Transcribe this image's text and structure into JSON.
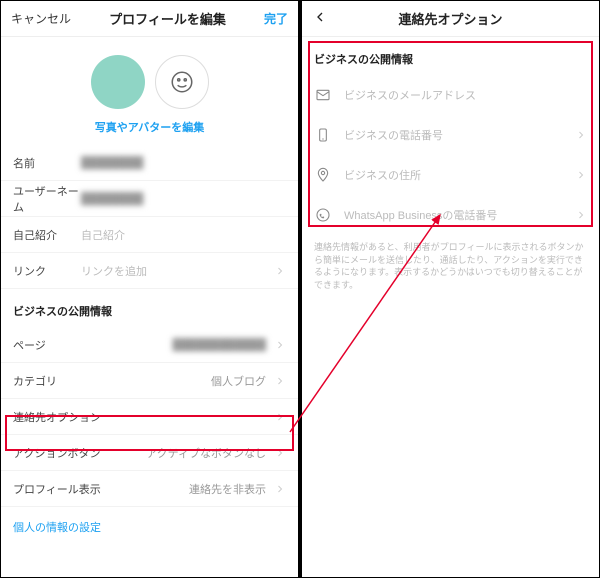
{
  "left": {
    "header": {
      "cancel": "キャンセル",
      "title": "プロフィールを編集",
      "done": "完了"
    },
    "avatar_link": "写真やアバターを編集",
    "fields": {
      "name_label": "名前",
      "username_label": "ユーザーネーム",
      "bio_label": "自己紹介",
      "bio_placeholder": "自己紹介",
      "links_label": "リンク",
      "links_placeholder": "リンクを追加"
    },
    "biz_section": "ビジネスの公開情報",
    "biz": {
      "page_label": "ページ",
      "category_label": "カテゴリ",
      "category_value": "個人ブログ",
      "contact_label": "連絡先オプション",
      "action_label": "アクションボタン",
      "action_value": "アクティブなボタンなし",
      "display_label": "プロフィール表示",
      "display_value": "連絡先を非表示"
    },
    "personal": "個人の情報の設定"
  },
  "right": {
    "header": {
      "title": "連絡先オプション"
    },
    "section_title": "ビジネスの公開情報",
    "rows": {
      "email": "ビジネスのメールアドレス",
      "phone": "ビジネスの電話番号",
      "address": "ビジネスの住所",
      "whatsapp": "WhatsApp Businessの電話番号"
    },
    "info": "連絡先情報があると、利用者がプロフィールに表示されるボタンから簡単にメールを送信したり、通話したり、アクションを実行できるようになります。表示するかどうかはいつでも切り替えることができます。"
  }
}
